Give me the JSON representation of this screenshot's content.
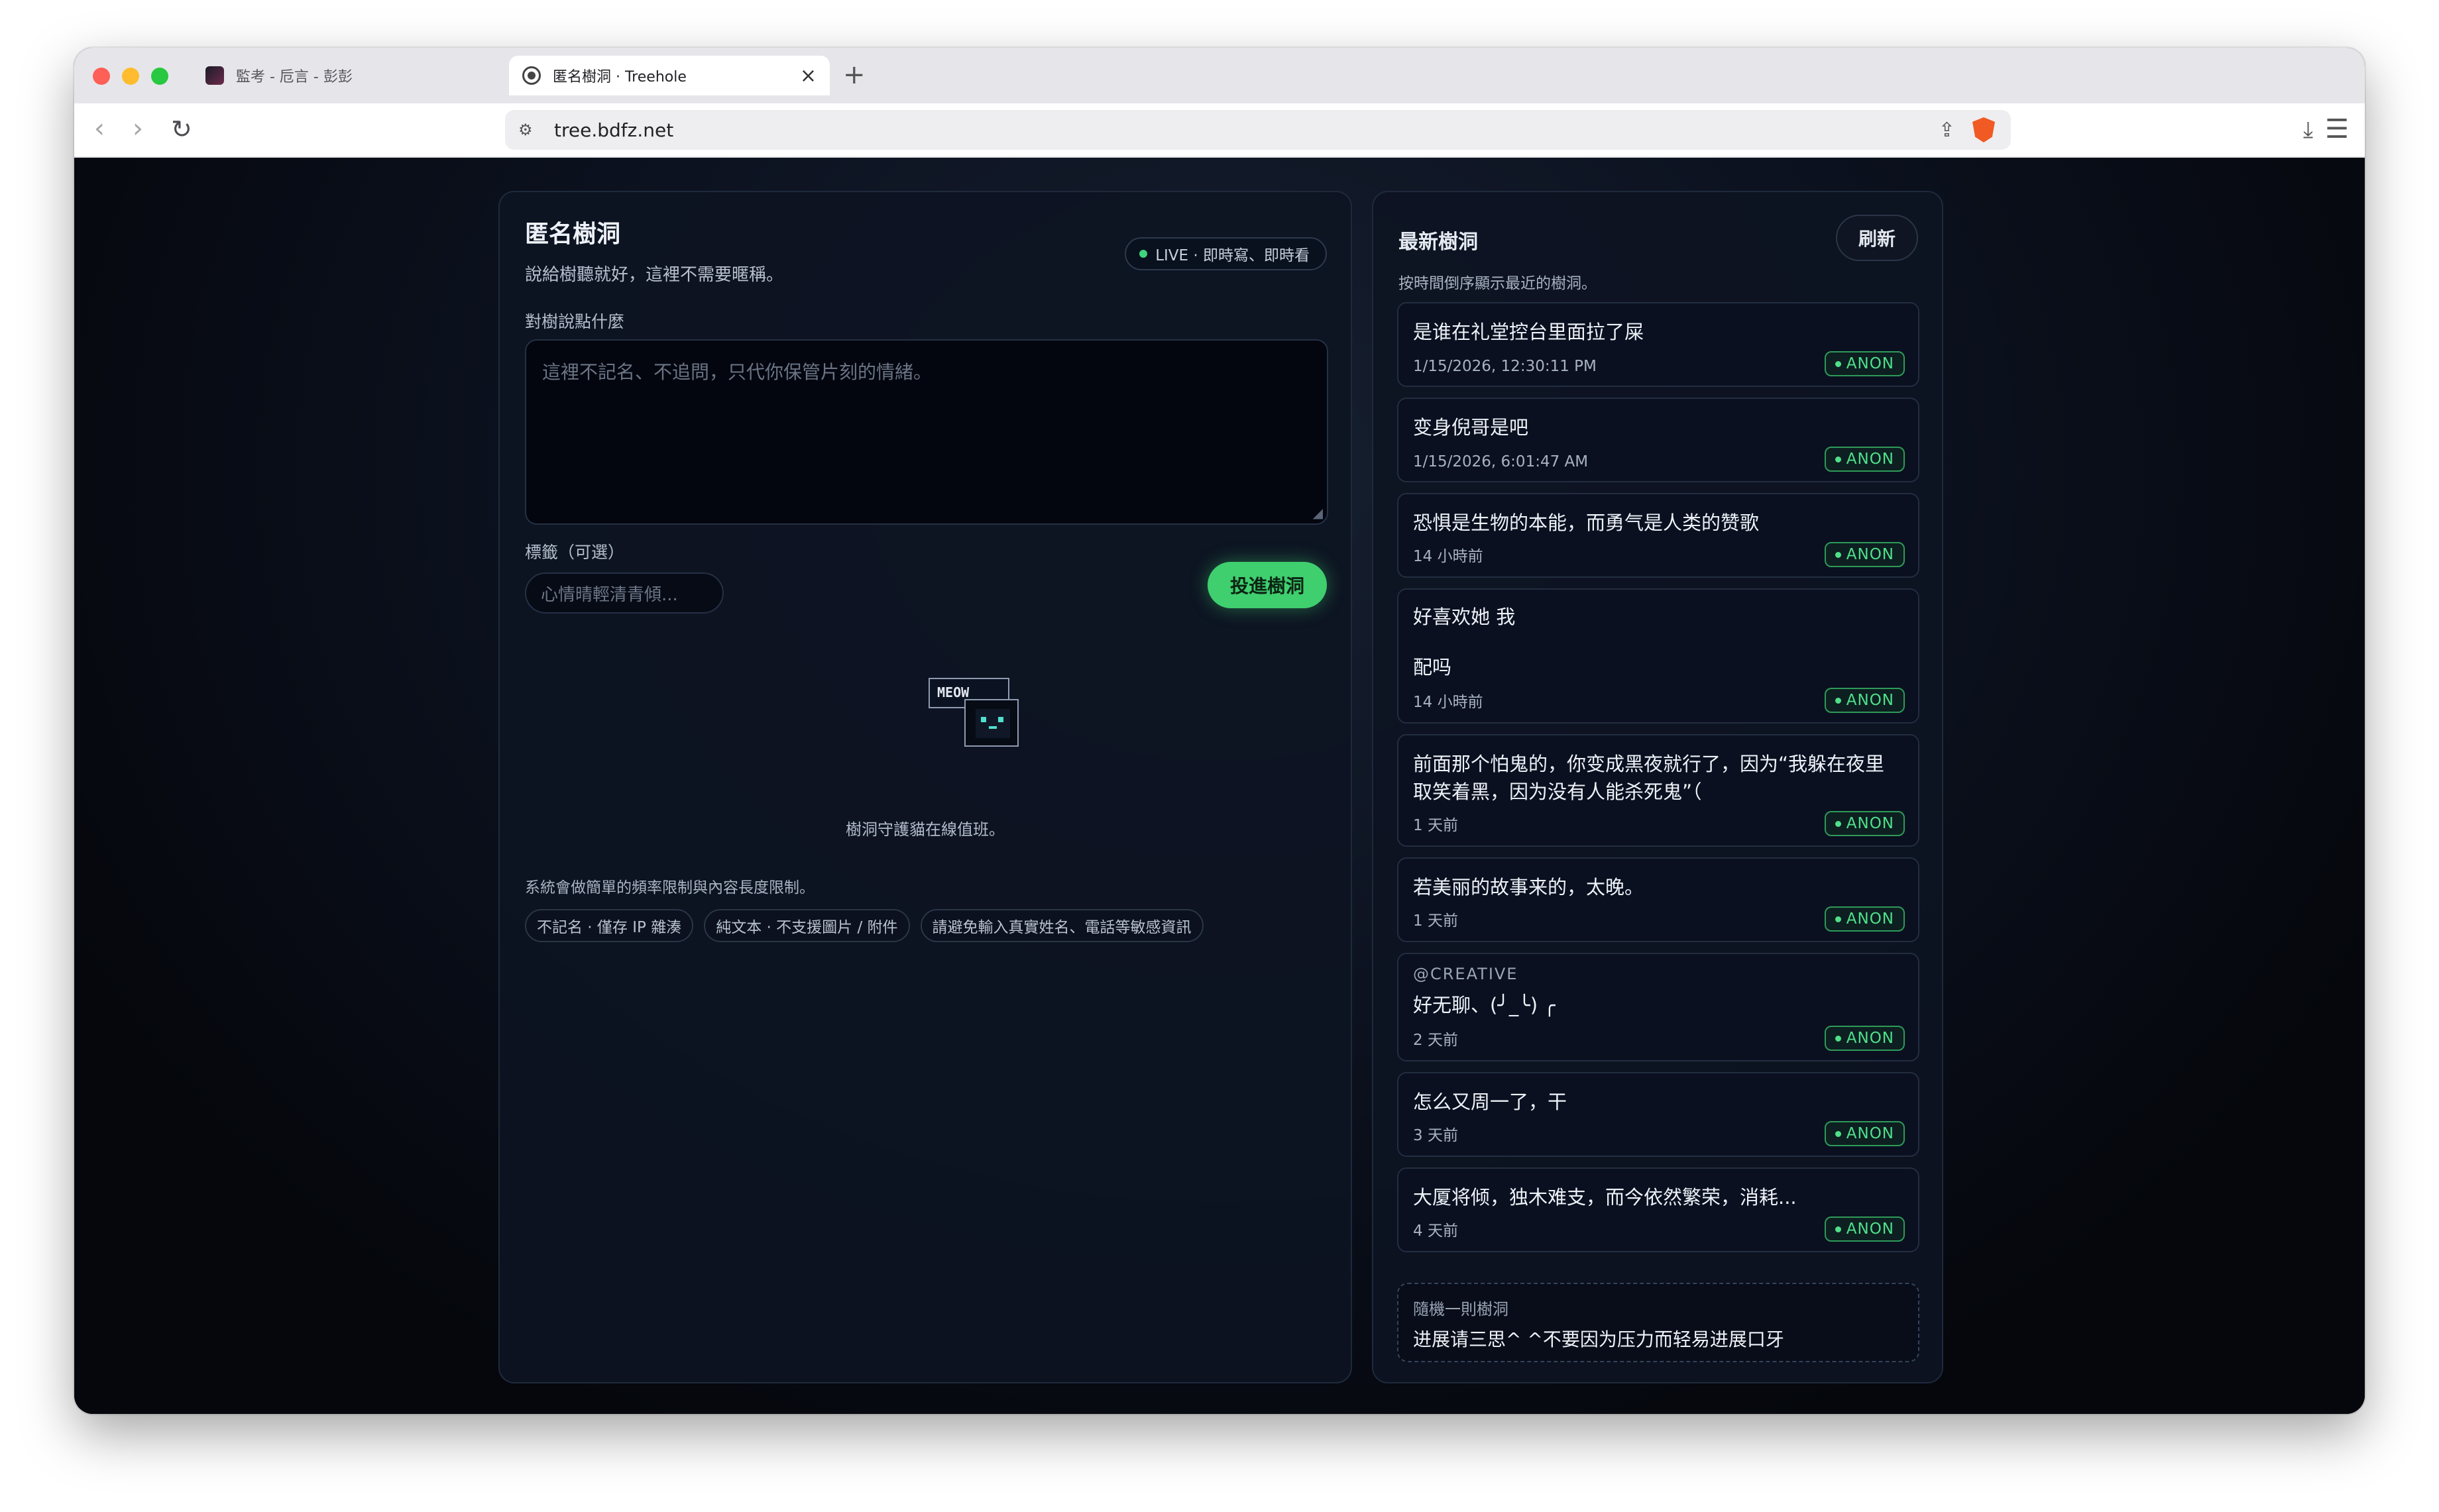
{
  "browser": {
    "tabs": [
      {
        "title": "監考 - 卮言 - 彭彭",
        "active": false
      },
      {
        "title": "匿名樹洞 · Treehole",
        "active": true
      }
    ],
    "new_tab": "+",
    "close_glyph": "×",
    "url": "tree.bdfz.net"
  },
  "composer": {
    "title": "匿名樹洞",
    "subtitle": "說給樹聽就好，這裡不需要暱稱。",
    "live_badge": "LIVE · 即時寫、即時看",
    "message_label": "對樹說點什麼",
    "message_placeholder": "這裡不記名、不追問，只代你保管片刻的情緒。",
    "tag_label": "標籤（可選）",
    "tag_placeholder": "心情晴輕清青傾...",
    "submit_label": "投進樹洞",
    "mascot_sign": "MEOW",
    "mascot_caption": "樹洞守護貓在線值班。",
    "limit_note": "系統會做簡單的頻率限制與內容長度限制。",
    "chips": [
      "不記名 · 僅存 IP 雜湊",
      "純文本 · 不支援圖片 / 附件",
      "請避免輸入真實姓名、電話等敏感資訊"
    ]
  },
  "feed": {
    "title": "最新樹洞",
    "refresh_label": "刷新",
    "subtitle": "按時間倒序顯示最近的樹洞。",
    "badge_label": "ANON",
    "posts": [
      {
        "tag": "",
        "text": "是谁在礼堂控台里面拉了屎",
        "time": "1/15/2026, 12:30:11 PM"
      },
      {
        "tag": "",
        "text": "变身倪哥是吧",
        "time": "1/15/2026, 6:01:47 AM"
      },
      {
        "tag": "",
        "text": "恐惧是生物的本能，而勇气是人类的赞歌",
        "time": "14 小時前"
      },
      {
        "tag": "",
        "text": "好喜欢她 我\n\n配吗",
        "time": "14 小時前"
      },
      {
        "tag": "",
        "text": "前面那个怕鬼的，你变成黑夜就行了，因为“我躲在夜里取笑着黑，因为没有人能杀死鬼”（",
        "time": "1 天前"
      },
      {
        "tag": "",
        "text": "若美丽的故事来的，太晚。",
        "time": "1 天前"
      },
      {
        "tag": "@CREATIVE",
        "text": "好无聊、(╯_╰) ╭",
        "time": "2 天前"
      },
      {
        "tag": "",
        "text": "怎么又周一了，干",
        "time": "3 天前"
      },
      {
        "tag": "",
        "text": "大厦将倾，独木难支，而今依然繁荣，消耗...",
        "time": "4 天前"
      }
    ],
    "random": {
      "label": "隨機一則樹洞",
      "text": "进展请三思^ ^不要因为压力而轻易进展口牙"
    }
  }
}
